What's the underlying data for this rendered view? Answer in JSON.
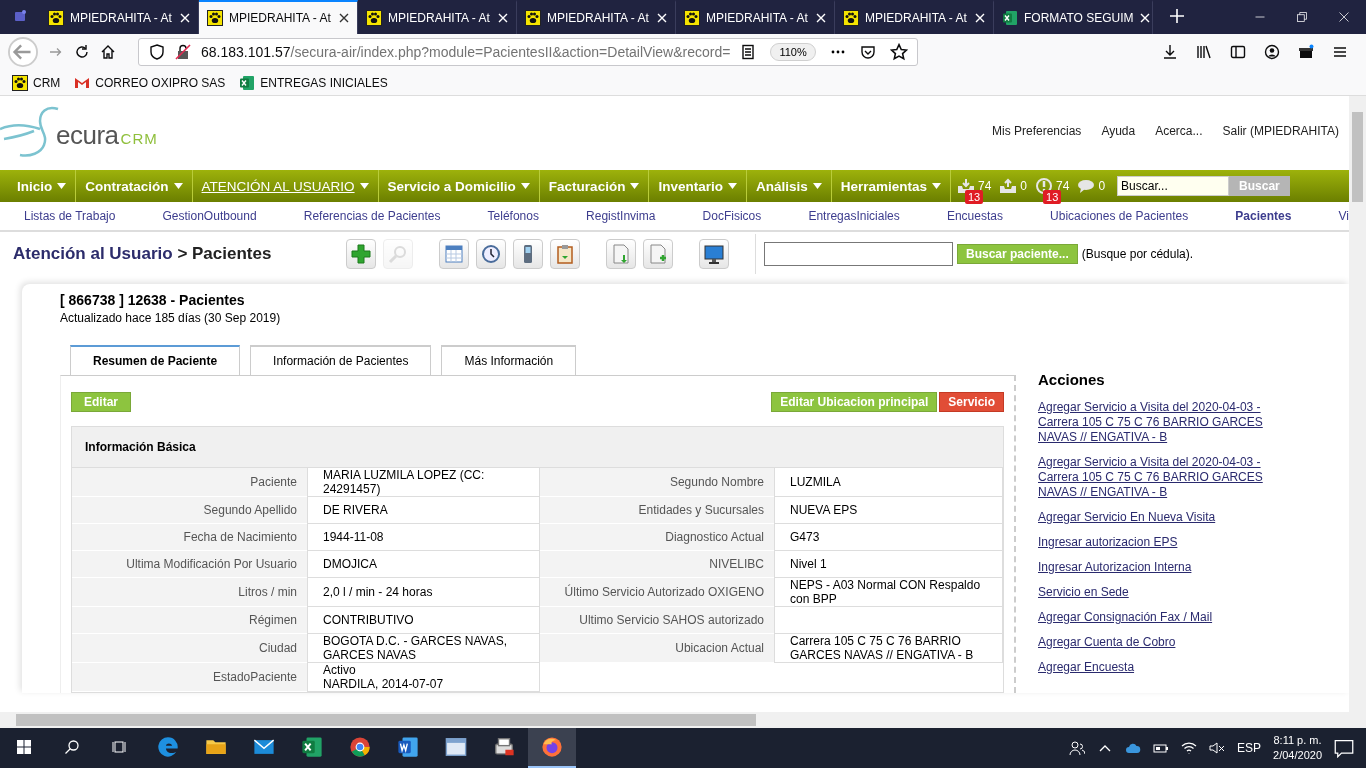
{
  "browser": {
    "tabs": [
      {
        "title": "MPIEDRAHITA - At",
        "kind": "site",
        "selected": false
      },
      {
        "title": "MPIEDRAHITA - At",
        "kind": "site",
        "selected": true
      },
      {
        "title": "MPIEDRAHITA - At",
        "kind": "site",
        "selected": false
      },
      {
        "title": "MPIEDRAHITA - At",
        "kind": "site",
        "selected": false
      },
      {
        "title": "MPIEDRAHITA - At",
        "kind": "site",
        "selected": false
      },
      {
        "title": "MPIEDRAHITA - At",
        "kind": "site",
        "selected": false
      },
      {
        "title": "FORMATO SEGUIM",
        "kind": "spreadsheet",
        "selected": false
      }
    ],
    "url_host": "68.183.101.57",
    "url_path": "/secura-air/index.php?module=PacientesII&action=DetailView&record=",
    "zoom": "110%",
    "bookmarks": [
      {
        "label": "CRM",
        "kind": "site"
      },
      {
        "label": "CORREO OXIPRO SAS",
        "kind": "mail"
      },
      {
        "label": "ENTREGAS INICIALES",
        "kind": "spreadsheet"
      }
    ]
  },
  "app": {
    "logo": {
      "text": "ecura",
      "accent": "CRM"
    },
    "top_links": [
      "Mis Preferencias",
      "Ayuda",
      "Acerca...",
      "Salir (MPIEDRAHITA)"
    ],
    "menu": [
      {
        "label": "Inicio",
        "selected": false
      },
      {
        "label": "Contratación",
        "selected": false
      },
      {
        "label": "ATENCIÓN AL USUARIO",
        "selected": true
      },
      {
        "label": "Servicio a Domicilio",
        "selected": false
      },
      {
        "label": "Facturación",
        "selected": false
      },
      {
        "label": "Inventario",
        "selected": false
      },
      {
        "label": "Análisis",
        "selected": false
      },
      {
        "label": "Herramientas",
        "selected": false
      }
    ],
    "counters": [
      {
        "kind": "inbox",
        "value": "74",
        "badge": "13"
      },
      {
        "kind": "outbox",
        "value": "0"
      },
      {
        "kind": "alert",
        "value": "74",
        "badge": "13"
      },
      {
        "kind": "chat",
        "value": "0"
      }
    ],
    "search": {
      "placeholder": "Buscar...",
      "button": "Buscar"
    },
    "submenu": [
      {
        "label": "Listas de Trabajo",
        "selected": false
      },
      {
        "label": "GestionOutbound",
        "selected": false
      },
      {
        "label": "Referencias de Pacientes",
        "selected": false
      },
      {
        "label": "Teléfonos",
        "selected": false
      },
      {
        "label": "RegistInvima",
        "selected": false
      },
      {
        "label": "DocFisicos",
        "selected": false
      },
      {
        "label": "EntregasIniciales",
        "selected": false
      },
      {
        "label": "Encuestas",
        "selected": false
      },
      {
        "label": "Ubicaciones de Pacientes",
        "selected": false
      },
      {
        "label": "Pacientes",
        "selected": true
      },
      {
        "label": "Vi",
        "selected": false
      }
    ],
    "breadcrumb": {
      "module": "Atención al Usuario",
      "page": "> Pacientes"
    },
    "toolbar": [
      {
        "buttons": [
          {
            "kind": "add",
            "disabled": false
          },
          {
            "kind": "search",
            "disabled": true
          }
        ]
      },
      {
        "buttons": [
          {
            "kind": "calendar",
            "disabled": false
          },
          {
            "kind": "clock",
            "disabled": false
          },
          {
            "kind": "phone",
            "disabled": false
          },
          {
            "kind": "clipboard",
            "disabled": false
          }
        ]
      },
      {
        "buttons": [
          {
            "kind": "import",
            "disabled": false
          },
          {
            "kind": "export",
            "disabled": false
          }
        ]
      },
      {
        "buttons": [
          {
            "kind": "monitor",
            "disabled": false
          }
        ]
      }
    ],
    "patient_search": {
      "button": "Buscar paciente...",
      "hint": "(Busque por cédula)."
    },
    "record": {
      "title": "[ 866738 ] 12638 - Pacientes",
      "updated": "Actualizado hace 185 días (30 Sep 2019)",
      "tabs": [
        {
          "label": "Resumen de Paciente",
          "selected": true
        },
        {
          "label": "Información de Pacientes",
          "selected": false
        },
        {
          "label": "Más Información",
          "selected": false
        }
      ],
      "edit_button": "Editar",
      "buttons": [
        {
          "label": "Editar Ubicacion principal",
          "kind": "primary"
        },
        {
          "label": "Servicio",
          "kind": "danger"
        }
      ],
      "section": "Información Básica",
      "rows": [
        [
          {
            "label": "Paciente",
            "value": "MARIA LUZMILA LOPEZ (CC: 24291457)"
          },
          {
            "label": "Segundo Nombre",
            "value": "LUZMILA"
          }
        ],
        [
          {
            "label": "Segundo Apellido",
            "value": "DE RIVERA"
          },
          {
            "label": "Entidades y Sucursales",
            "value": "NUEVA EPS"
          }
        ],
        [
          {
            "label": "Fecha de Nacimiento",
            "value": "1944-11-08"
          },
          {
            "label": "Diagnostico Actual",
            "value": "G473"
          }
        ],
        [
          {
            "label": "Ultima Modificación Por Usuario",
            "value": "DMOJICA"
          },
          {
            "label": "NIVELIBC",
            "value": "Nivel 1"
          }
        ],
        [
          {
            "label": "Litros / min",
            "value": "2,0 l / min - 24 horas"
          },
          {
            "label": "Último Servicio Autorizado OXIGENO",
            "value": "NEPS - A03 Normal CON Respaldo con BPP"
          }
        ],
        [
          {
            "label": "Régimen",
            "value": "CONTRIBUTIVO"
          },
          {
            "label": "Ultimo Servicio SAHOS autorizado"
          }
        ],
        [
          {
            "label": "Ciudad",
            "value": "BOGOTA D.C. - GARCES NAVAS, GARCES NAVAS"
          },
          {
            "label": "Ubicacion Actual",
            "value": "Carrera 105 C 75 C 76 BARRIO GARCES NAVAS // ENGATIVA - B"
          }
        ],
        [
          {
            "label": "EstadoPaciente",
            "value": "Activo",
            "note": "NARDILA, 2014-07-07"
          }
        ]
      ]
    },
    "actions": {
      "title": "Acciones",
      "links": [
        "Agregar Servicio a Visita del 2020-04-03 - Carrera 105 C 75 C 76 BARRIO GARCES NAVAS // ENGATIVA - B",
        "Agregar Servicio a Visita del 2020-04-03 - Carrera 105 C 75 C 76 BARRIO GARCES NAVAS // ENGATIVA - B",
        "Agregar Servicio En Nueva Visita",
        "Ingresar autorizacion EPS",
        "Ingresar Autorizacion Interna",
        "Servicio en Sede",
        "Agregar Consignación Fax / Mail",
        "Agregar Cuenta de Cobro",
        "Agregar Encuesta"
      ]
    }
  },
  "taskbar": {
    "apps": [
      {
        "kind": "edge",
        "active": false
      },
      {
        "kind": "folder",
        "active": false
      },
      {
        "kind": "mail",
        "active": false
      },
      {
        "kind": "excel",
        "active": false
      },
      {
        "kind": "chrome",
        "active": false
      },
      {
        "kind": "word",
        "active": false
      },
      {
        "kind": "window",
        "active": false
      },
      {
        "kind": "pdf",
        "active": false
      },
      {
        "kind": "firefox",
        "active": true
      }
    ],
    "language": "ESP",
    "time": "8:11 p. m.",
    "date": "2/04/2020"
  }
}
